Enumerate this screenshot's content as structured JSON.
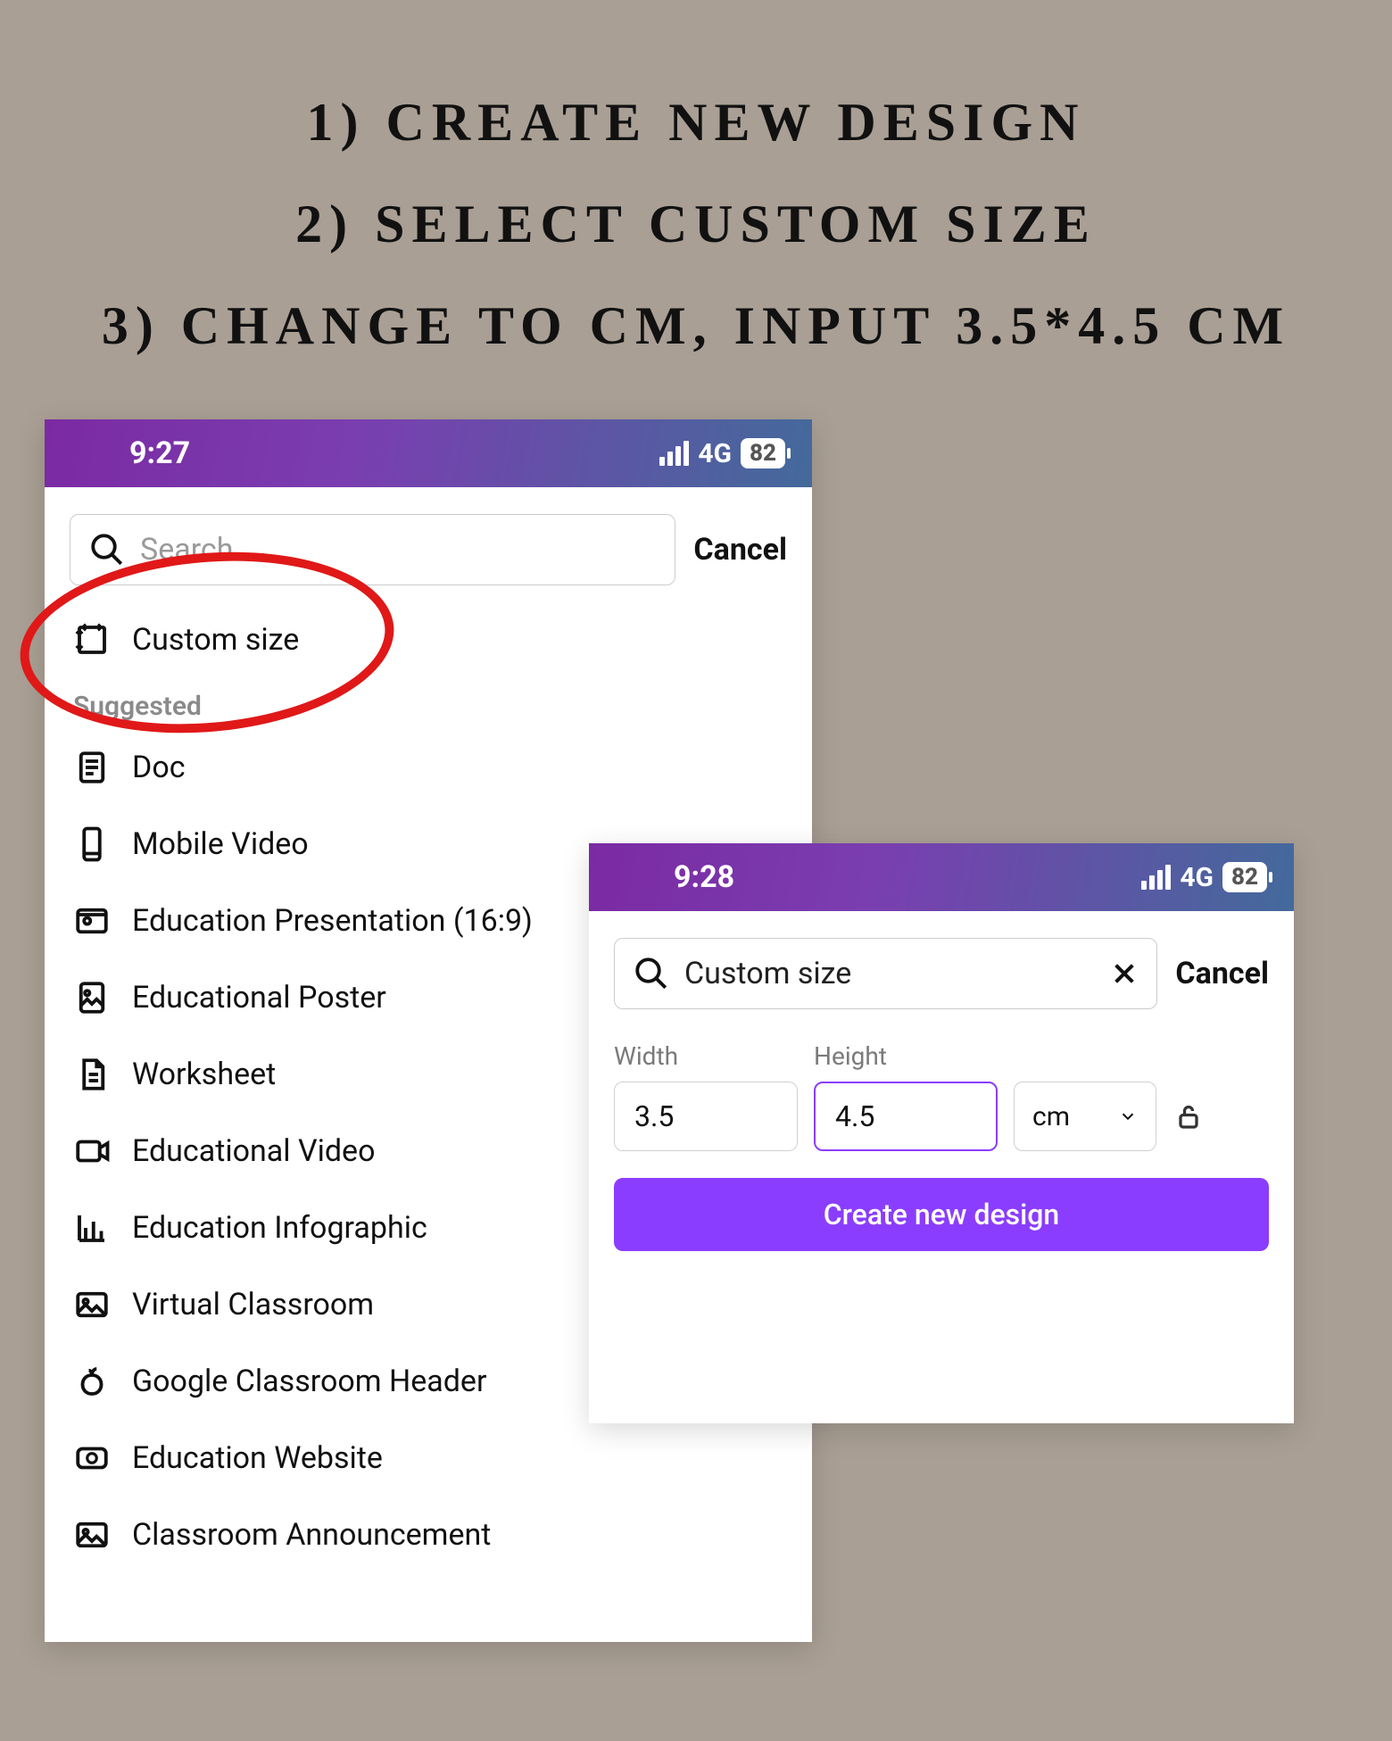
{
  "instructions": {
    "line1": "1) CREATE NEW DESIGN",
    "line2": "2) SELECT CUSTOM SIZE",
    "line3": "3) CHANGE TO CM, INPUT 3.5*4.5 CM"
  },
  "phone1": {
    "status": {
      "time": "9:27",
      "network": "4G",
      "battery": "82"
    },
    "search": {
      "placeholder": "Search"
    },
    "cancel": "Cancel",
    "custom_size": "Custom size",
    "suggested_title": "Suggested",
    "items": [
      {
        "label": "Doc"
      },
      {
        "label": "Mobile Video"
      },
      {
        "label": "Education Presentation (16:9)"
      },
      {
        "label": "Educational Poster"
      },
      {
        "label": "Worksheet"
      },
      {
        "label": "Educational Video"
      },
      {
        "label": "Education Infographic"
      },
      {
        "label": "Virtual Classroom"
      },
      {
        "label": "Google Classroom Header"
      },
      {
        "label": "Education Website"
      },
      {
        "label": "Classroom Announcement"
      }
    ]
  },
  "phone2": {
    "status": {
      "time": "9:28",
      "network": "4G",
      "battery": "82"
    },
    "search": {
      "value": "Custom size"
    },
    "cancel": "Cancel",
    "width_label": "Width",
    "height_label": "Height",
    "width_value": "3.5",
    "height_value": "4.5",
    "unit": "cm",
    "create_button": "Create new design"
  }
}
